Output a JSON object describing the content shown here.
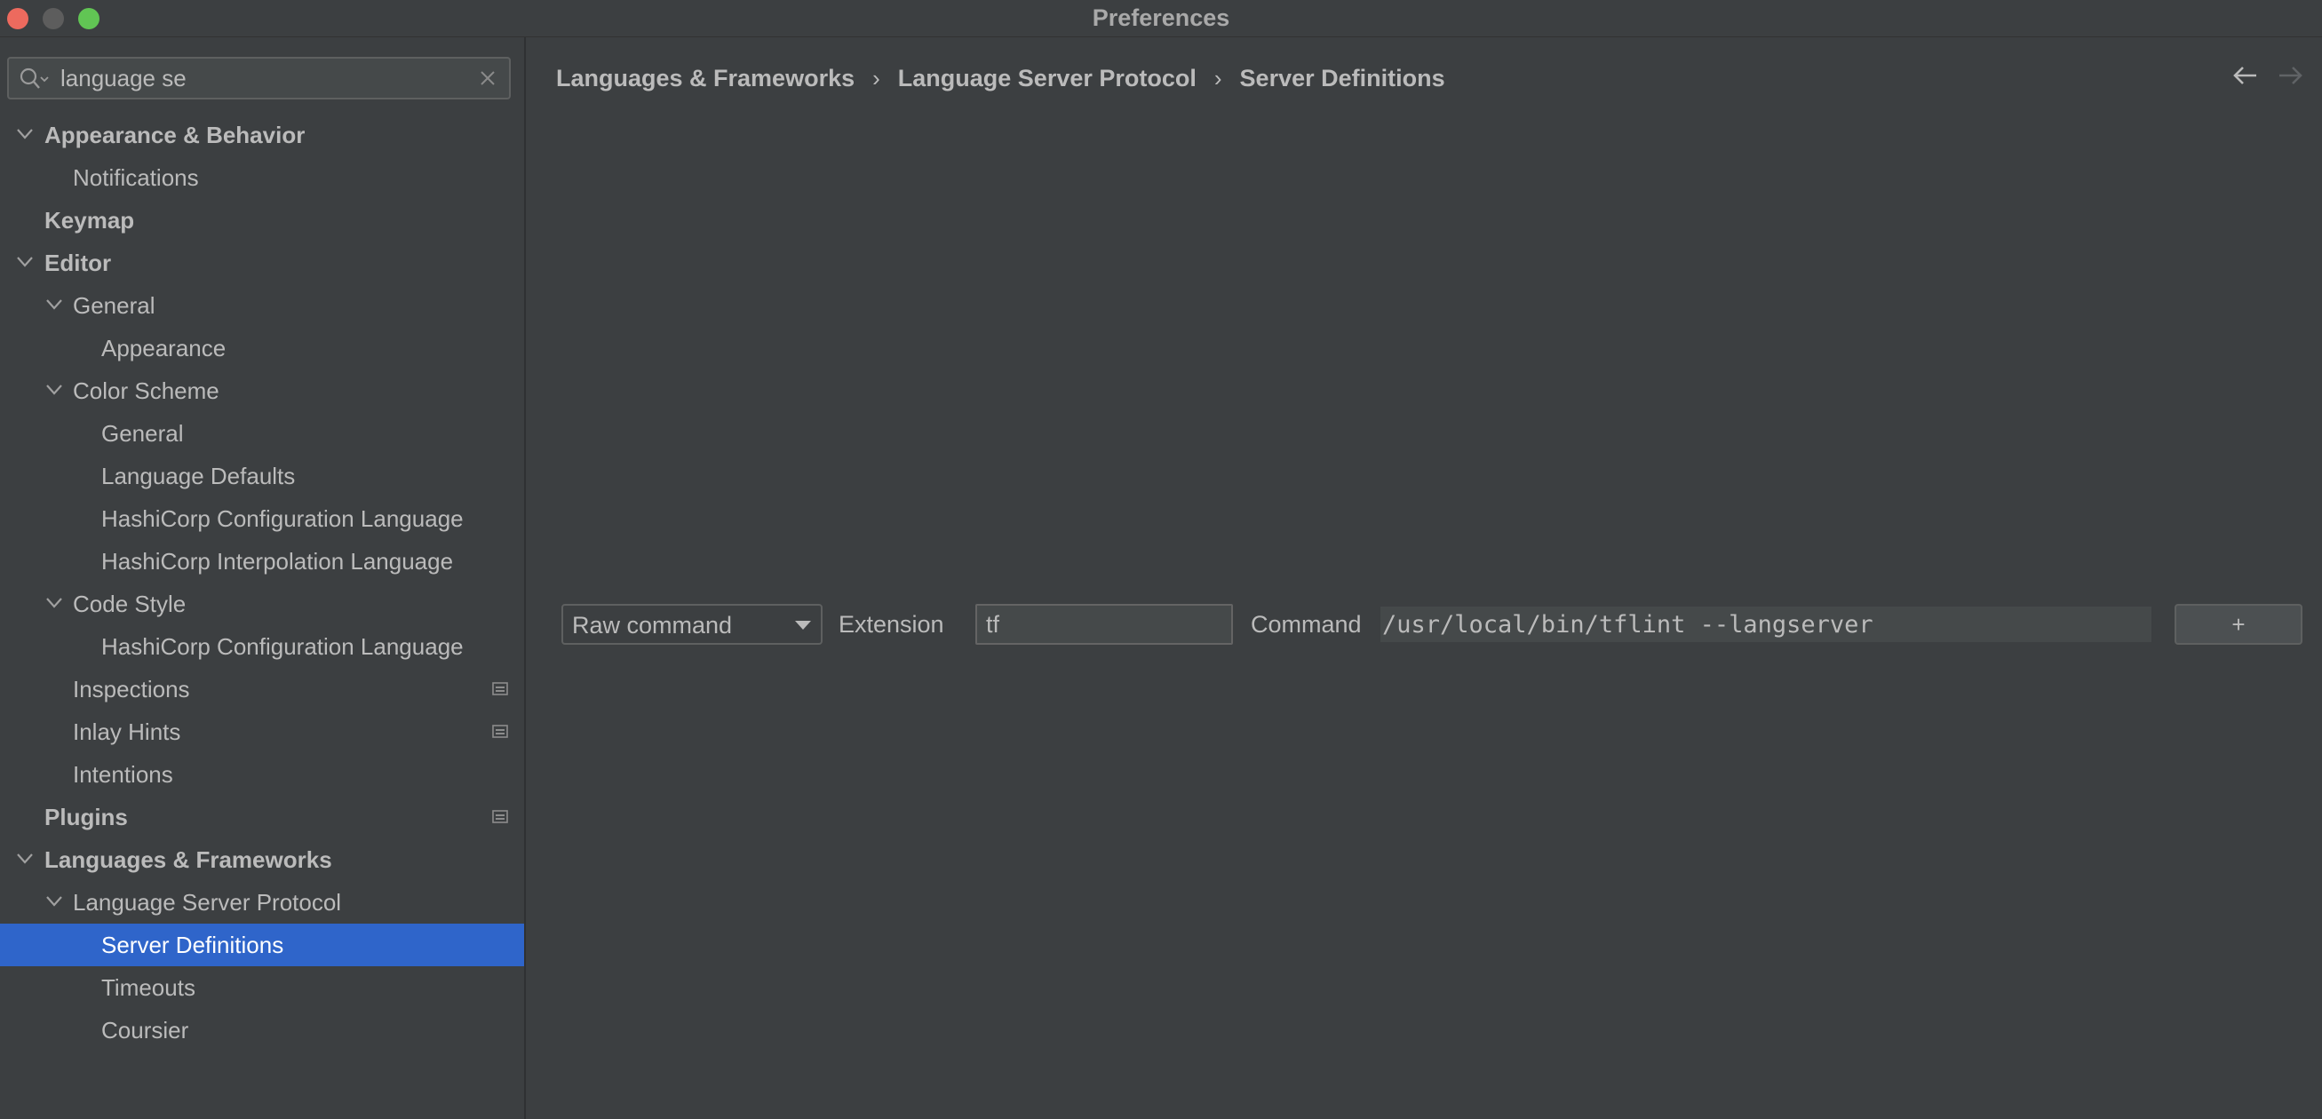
{
  "window": {
    "title": "Preferences"
  },
  "search": {
    "value": "language se"
  },
  "tree": [
    {
      "label": "Appearance & Behavior"
    },
    {
      "label": "Notifications"
    },
    {
      "label": "Keymap"
    },
    {
      "label": "Editor"
    },
    {
      "label": "General"
    },
    {
      "label": "Appearance"
    },
    {
      "label": "Color Scheme"
    },
    {
      "label": "General"
    },
    {
      "label": "Language Defaults"
    },
    {
      "label": "HashiCorp Configuration Language"
    },
    {
      "label": "HashiCorp Interpolation Language"
    },
    {
      "label": "Code Style"
    },
    {
      "label": "HashiCorp Configuration Language"
    },
    {
      "label": "Inspections"
    },
    {
      "label": "Inlay Hints"
    },
    {
      "label": "Intentions"
    },
    {
      "label": "Plugins"
    },
    {
      "label": "Languages & Frameworks"
    },
    {
      "label": "Language Server Protocol"
    },
    {
      "label": "Server Definitions"
    },
    {
      "label": "Timeouts"
    },
    {
      "label": "Coursier"
    }
  ],
  "breadcrumb": {
    "items": [
      "Languages & Frameworks",
      "Language Server Protocol",
      "Server Definitions"
    ],
    "separator": "›"
  },
  "definition": {
    "type_selected": "Raw command",
    "extension_label": "Extension",
    "extension_value": "tf",
    "command_label": "Command",
    "command_value": "/usr/local/bin/tflint --langserver",
    "add_label": "+"
  },
  "colors": {
    "background": "#3c3f41",
    "selection": "#2f65ca",
    "text": "#bbbbbb"
  }
}
